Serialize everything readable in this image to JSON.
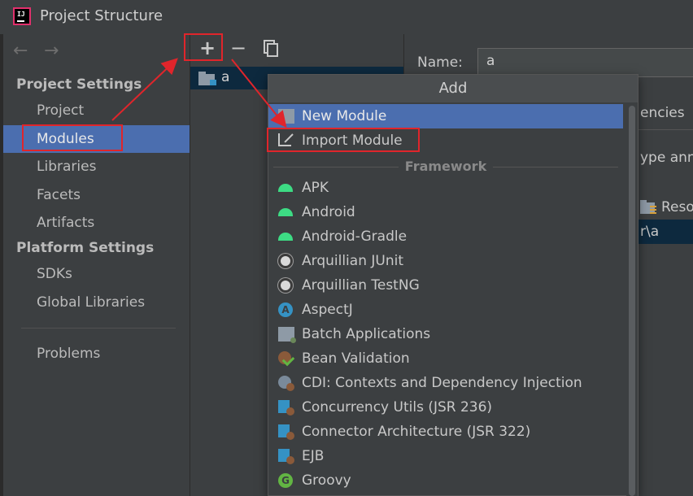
{
  "window": {
    "title": "Project Structure",
    "logo_text": "IJ"
  },
  "nav": {
    "back": "←",
    "forward": "→"
  },
  "sidebar": {
    "project_settings_header": "Project Settings",
    "platform_settings_header": "Platform Settings",
    "items": [
      {
        "label": "Project"
      },
      {
        "label": "Modules",
        "selected": true
      },
      {
        "label": "Libraries"
      },
      {
        "label": "Facets"
      },
      {
        "label": "Artifacts"
      },
      {
        "label": "SDKs"
      },
      {
        "label": "Global Libraries"
      },
      {
        "label": "Problems"
      }
    ]
  },
  "toolbar": {
    "add": "+",
    "remove": "−"
  },
  "module_tree": {
    "items": [
      {
        "label": "a"
      }
    ]
  },
  "right_panel": {
    "name_label": "Name:",
    "name_value": "a",
    "partial_tab": "encies",
    "partial_type": "ype ann",
    "partial_resource": "Reso",
    "partial_path": "r\\a"
  },
  "add_popup": {
    "header": "Add",
    "group_label": "Framework",
    "top_items": [
      {
        "label": "New Module",
        "icon": "folder-icon",
        "selected": true
      },
      {
        "label": "Import Module",
        "icon": "import-icon"
      }
    ],
    "framework_items": [
      {
        "label": "APK",
        "icon": "android-icon"
      },
      {
        "label": "Android",
        "icon": "android-icon"
      },
      {
        "label": "Android-Gradle",
        "icon": "android-icon"
      },
      {
        "label": "Arquillian JUnit",
        "icon": "arquillian-icon"
      },
      {
        "label": "Arquillian TestNG",
        "icon": "arquillian-icon"
      },
      {
        "label": "AspectJ",
        "icon": "aspectj-icon"
      },
      {
        "label": "Batch Applications",
        "icon": "batch-icon"
      },
      {
        "label": "Bean Validation",
        "icon": "bean-validation-icon"
      },
      {
        "label": "CDI: Contexts and Dependency Injection",
        "icon": "cdi-icon"
      },
      {
        "label": "Concurrency Utils (JSR 236)",
        "icon": "jee-icon"
      },
      {
        "label": "Connector Architecture (JSR 322)",
        "icon": "jee-icon"
      },
      {
        "label": "EJB",
        "icon": "jee-icon"
      },
      {
        "label": "Groovy",
        "icon": "groovy-icon"
      }
    ]
  },
  "colors": {
    "selection": "#4b6eaf",
    "annotation_red": "#e0252b",
    "background": "#3c3f41"
  }
}
